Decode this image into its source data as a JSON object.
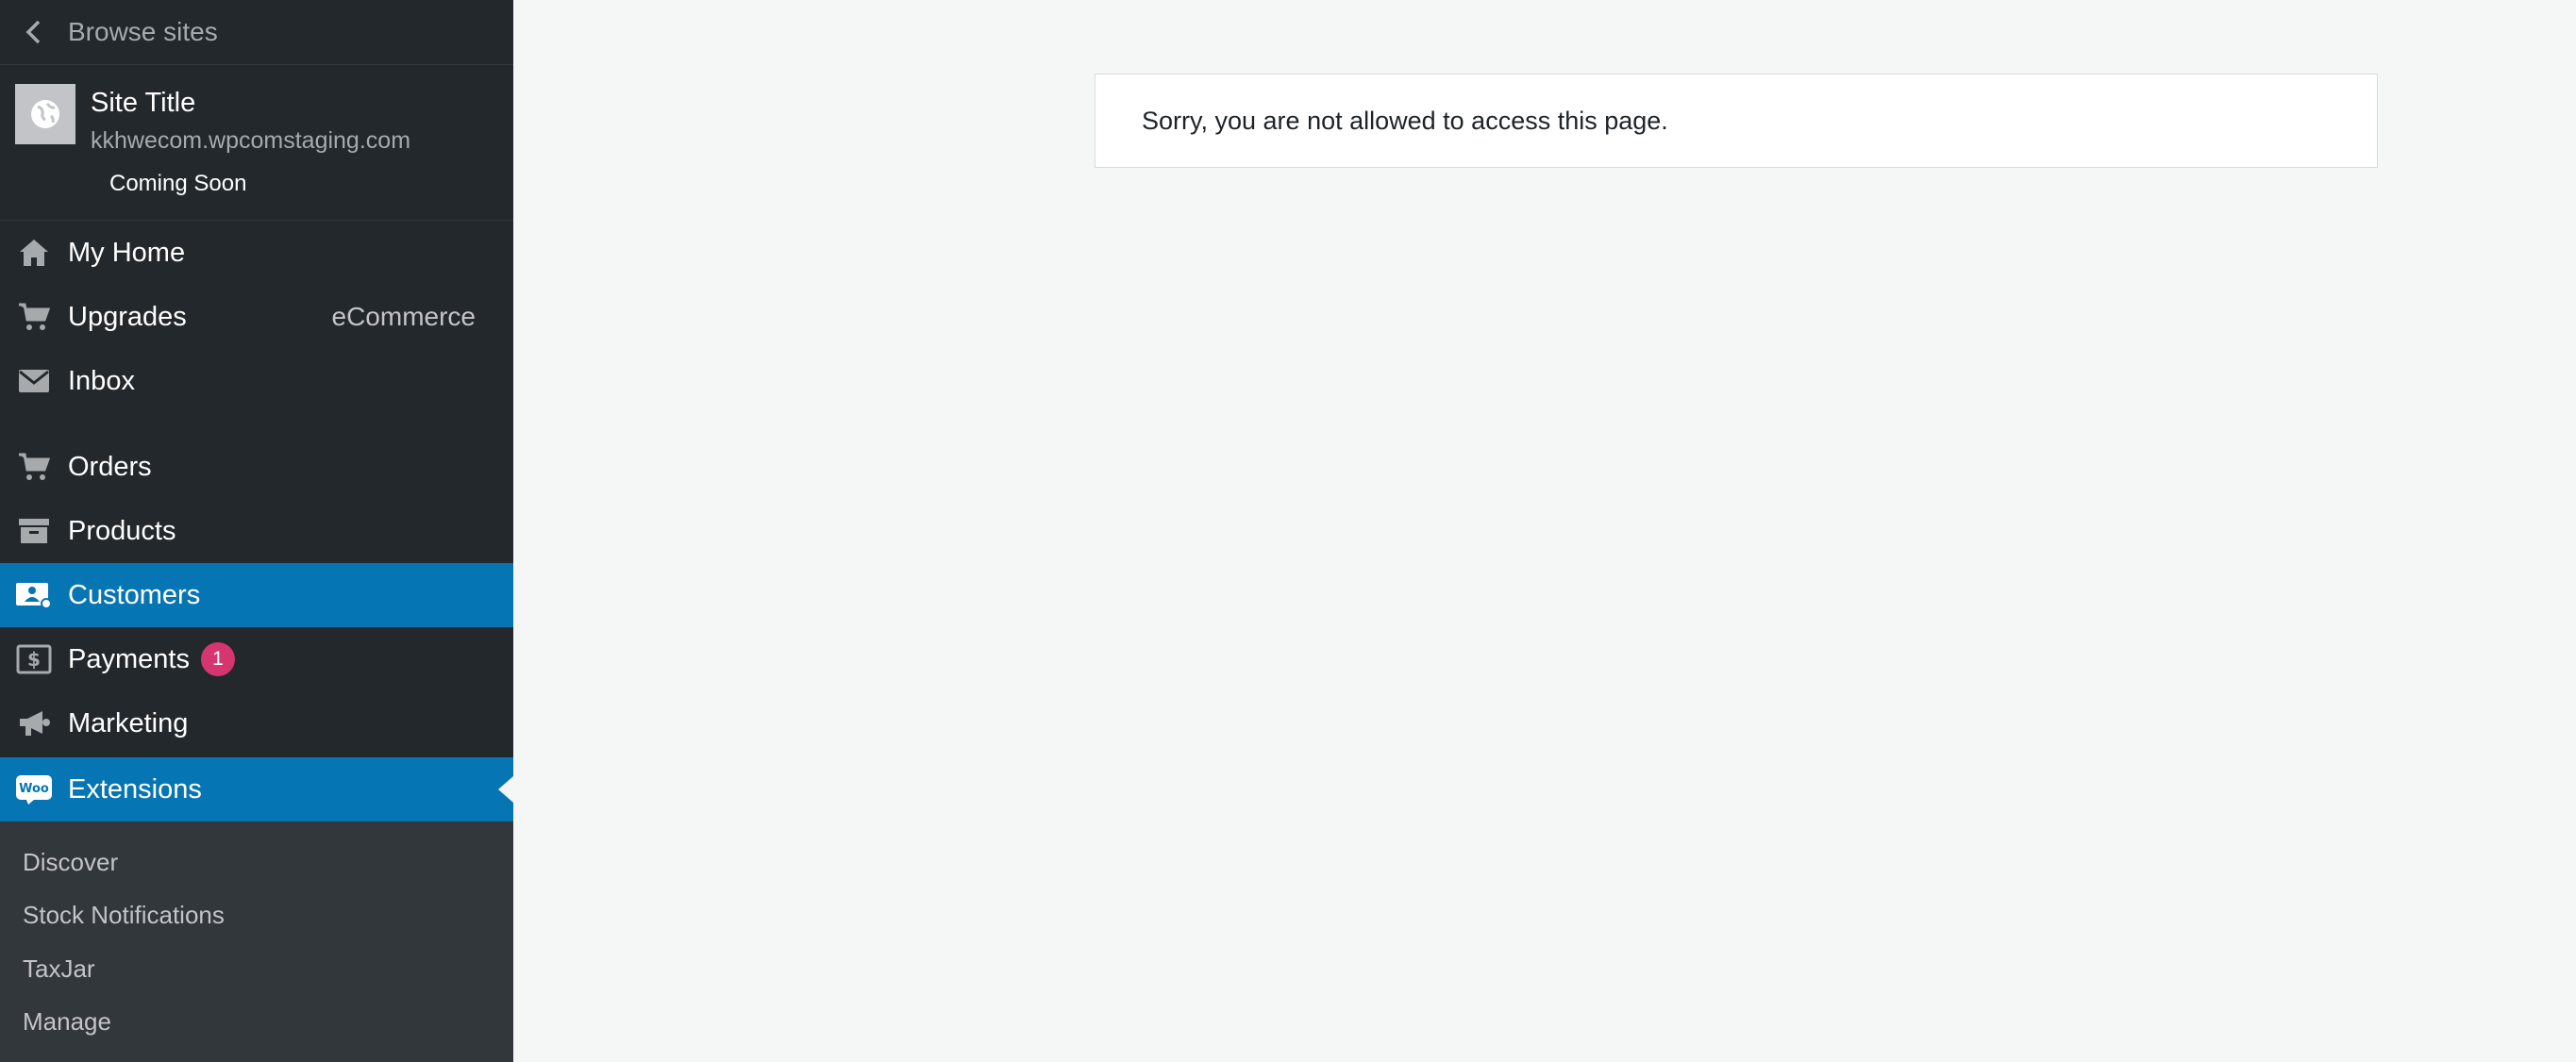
{
  "sidebar": {
    "browse_label": "Browse sites",
    "site": {
      "title": "Site Title",
      "domain": "kkhwecom.wpcomstaging.com",
      "status": "Coming Soon"
    },
    "items": [
      {
        "label": "My Home",
        "icon": "home-icon"
      },
      {
        "label": "Upgrades",
        "icon": "cart-icon",
        "extra": "eCommerce"
      },
      {
        "label": "Inbox",
        "icon": "envelope-icon"
      },
      {
        "label": "Orders",
        "icon": "cart-icon"
      },
      {
        "label": "Products",
        "icon": "archive-icon"
      },
      {
        "label": "Customers",
        "icon": "customers-icon",
        "active": true
      },
      {
        "label": "Payments",
        "icon": "payments-icon",
        "badge": "1"
      },
      {
        "label": "Marketing",
        "icon": "megaphone-icon"
      },
      {
        "label": "Extensions",
        "icon": "woo-icon",
        "active": true,
        "woo_text": "Woo"
      }
    ],
    "submenu": [
      "Discover",
      "Stock Notifications",
      "TaxJar",
      "Manage"
    ],
    "accent_color": "#0675b3",
    "badge_color": "#d63670"
  },
  "main": {
    "notice": "Sorry, you are not allowed to access this page."
  }
}
